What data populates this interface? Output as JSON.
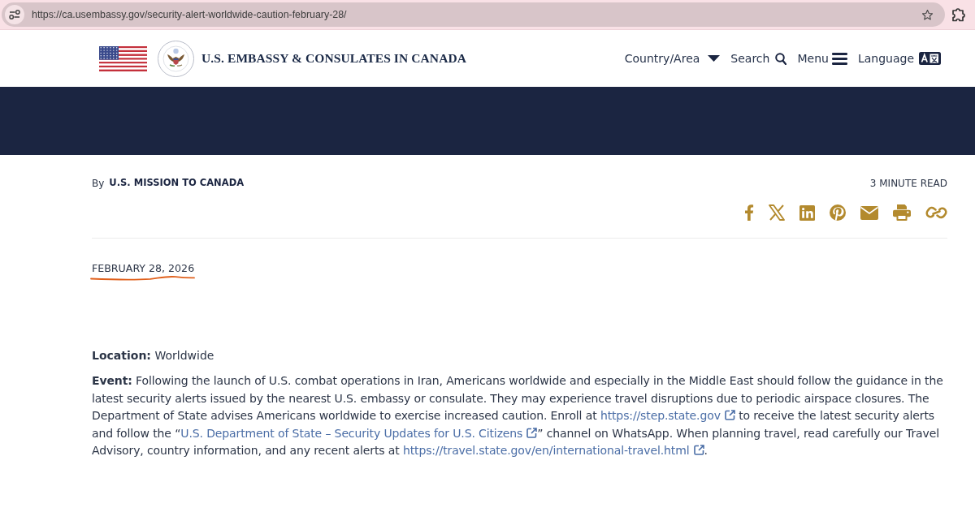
{
  "browser": {
    "url": "https://ca.usembassy.gov/security-alert-worldwide-caution-february-28/"
  },
  "header": {
    "site_title": "U.S. EMBASSY & CONSULATES IN CANADA",
    "nav": [
      {
        "label": "Country/Area",
        "kind": "dropdown"
      },
      {
        "label": "Search",
        "kind": "search"
      },
      {
        "label": "Menu",
        "kind": "menu"
      },
      {
        "label": "Language",
        "kind": "language"
      }
    ]
  },
  "byline": {
    "prefix": "By",
    "author": "U.S. MISSION TO CANADA",
    "read_time": "3 MINUTE READ"
  },
  "date": {
    "text": "FEBRUARY 28, 2026",
    "underlined": true
  },
  "location": {
    "text": "**Location:** Worldwide"
  },
  "event": {
    "parts": [
      {
        "kind": "text",
        "text": "**Event:** Following the launch of U.S. combat operations in Iran, Americans worldwide and especially in the Middle East should follow the guidance in the latest security alerts issued by the nearest U.S. embassy or consulate. They may experience travel disruptions due to periodic airspace closures. The Department of State advises Americans worldwide to exercise increased caution. Enroll at "
      },
      {
        "kind": "link",
        "text": "https://step.state.gov",
        "external": true
      },
      {
        "kind": "text",
        "text": " to receive the latest security alerts and follow the “"
      },
      {
        "kind": "link",
        "text": "U.S. Department of State – Security Updates for U.S. Citizens",
        "external": true
      },
      {
        "kind": "text",
        "text": "” channel on WhatsApp. When planning travel, read carefully our Travel Advisory, country information, and any recent alerts at "
      },
      {
        "kind": "link",
        "text": "https://travel.state.gov/en/international-travel.html",
        "external": true
      },
      {
        "kind": "text",
        "text": "."
      }
    ]
  }
}
